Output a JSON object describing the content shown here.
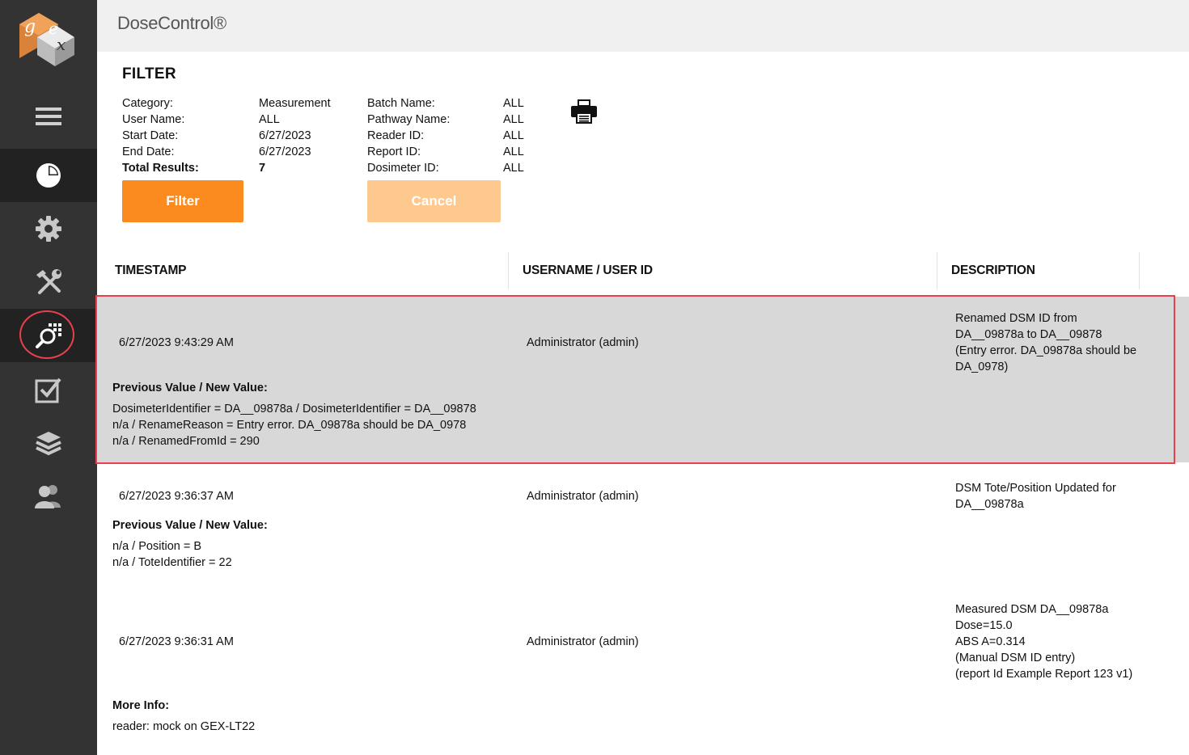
{
  "app": {
    "title": "DoseControl®"
  },
  "logo": {
    "letters": [
      "g",
      "e",
      "x"
    ]
  },
  "sidebar": {
    "items": [
      {
        "icon": "menu-icon"
      },
      {
        "icon": "dashboard-pie-icon"
      },
      {
        "icon": "settings-gear-icon"
      },
      {
        "icon": "tools-icon"
      },
      {
        "icon": "audit-search-icon"
      },
      {
        "icon": "checklist-icon"
      },
      {
        "icon": "layers-icon"
      },
      {
        "icon": "users-icon"
      }
    ]
  },
  "filter": {
    "title": "FILTER",
    "left_labels": [
      "Category:",
      "User Name:",
      "Start Date:",
      "End Date:",
      "Total Results:"
    ],
    "left_values": [
      "Measurement",
      "ALL",
      "6/27/2023",
      "6/27/2023",
      "7"
    ],
    "right_labels": [
      "Batch Name:",
      "Pathway Name:",
      "Reader ID:",
      "Report ID:",
      "Dosimeter ID:"
    ],
    "right_values": [
      "ALL",
      "ALL",
      "ALL",
      "ALL",
      "ALL"
    ],
    "filter_button": "Filter",
    "cancel_button": "Cancel"
  },
  "table": {
    "headers": [
      "TIMESTAMP",
      "USERNAME / USER ID",
      "DESCRIPTION"
    ],
    "rows": [
      {
        "timestamp": "6/27/2023 9:43:29 AM",
        "user": "Administrator (admin)",
        "description": [
          "Renamed DSM ID from",
          "DA__09878a to DA__09878",
          "(Entry error. DA_09878a should be",
          "DA_0978)"
        ],
        "detail_title": "Previous Value / New Value:",
        "detail_lines": [
          "DosimeterIdentifier = DA__09878a / DosimeterIdentifier = DA__09878",
          "n/a / RenameReason = Entry error. DA_09878a should be DA_0978",
          "n/a / RenamedFromId = 290"
        ]
      },
      {
        "timestamp": "6/27/2023 9:36:37 AM",
        "user": "Administrator (admin)",
        "description": [
          "DSM Tote/Position Updated for",
          "DA__09878a"
        ],
        "detail_title": "Previous Value / New Value:",
        "detail_lines": [
          "n/a / Position = B",
          "n/a / ToteIdentifier = 22"
        ]
      },
      {
        "timestamp": "6/27/2023 9:36:31 AM",
        "user": "Administrator (admin)",
        "description": [
          "Measured DSM DA__09878a",
          "Dose=15.0",
          "ABS A=0.314",
          "(Manual DSM ID entry)",
          "(report Id Example Report 123 v1)"
        ],
        "detail_title": "More Info:",
        "detail_lines": [
          "reader: mock on GEX-LT22"
        ]
      }
    ]
  },
  "colors": {
    "sidebar": "#333333",
    "accent": "#fb8b1e",
    "accent_disabled": "#fdc98f",
    "highlight_border": "#e8404d",
    "row_selected": "#d8d8d8"
  }
}
